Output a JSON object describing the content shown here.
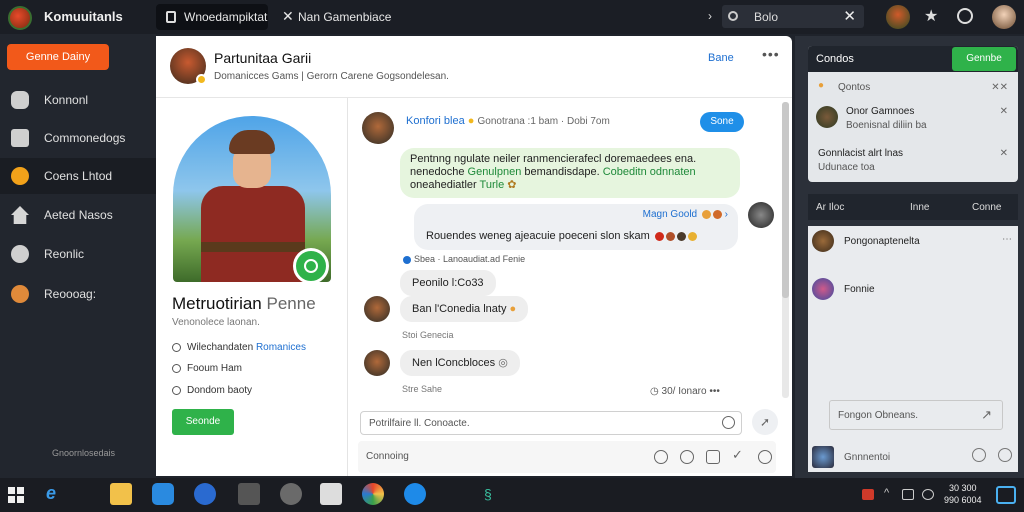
{
  "app": {
    "title": "Komuuitanls"
  },
  "tabs": [
    {
      "label": "Wnoedampiktat"
    },
    {
      "label": "Nan Gamenbiace"
    }
  ],
  "search": {
    "value": "Bolo"
  },
  "sidebar": {
    "cta_label": "Genne Dainy",
    "items": [
      {
        "label": "Konnonl"
      },
      {
        "label": "Commonedogs"
      },
      {
        "label": "Coens Lhtod"
      },
      {
        "label": "Aeted Nasos"
      },
      {
        "label": "Reonlic"
      },
      {
        "label": "Reoooag:"
      }
    ],
    "footer": "Gnoornlosedais"
  },
  "header": {
    "title": "Partunitaa Garii",
    "subtitle": "Domanicces  Gams  |  Gerorn  Carene   Gogsondelesan.",
    "link": "Bane"
  },
  "profile": {
    "name": "Metruotirian",
    "name_suffix": "Penne",
    "subtitle": "Venonolece laonan.",
    "details": [
      {
        "text": "Wilechandaten",
        "link": "Romanices"
      },
      {
        "text": "Fooum Ham"
      },
      {
        "text": "Dondom baoty"
      }
    ],
    "button": "Seonde"
  },
  "chat": {
    "sender_name": "Konfori blea",
    "sender_meta": "Gonotrana :1 bam  ·  Dobi 7om",
    "pill": "Sone",
    "green_message_plain": "Pentnng ngulate neiler ranmencierafecl doremaedees ena.",
    "green_message_line2": "nenedoche",
    "green_message_line2_hl": "Genulpnen",
    "green_message_line2_rest": "bemandisdape.",
    "green_message_line2_hl2": "Cobeditn odnnaten",
    "green_message_line3": "oneahediatler",
    "green_message_line3_hl": "Turle",
    "grey_top": "Magn Goold",
    "grey_bottom": "Rouendes weneg ajeacuie poeceni slon skam",
    "meta_line": "Sbea  ·  Lanoaudiat.ad  Fenie",
    "msg1": "Peonilo l:Co33",
    "msg2": "Ban l'Conedia lnaty",
    "time2": "Stoi  Genecia",
    "msg3": "Nen lConcbloces",
    "time3": "Stre  Sahe",
    "row_meta": "30/  Ionaro",
    "compose_placeholder": "Potrilfaire ll. Conoacte.",
    "toolbar_placeholder": "Connoing"
  },
  "right": {
    "header": "Condos",
    "header_button": "Gennbe",
    "rows": [
      {
        "text": "Qontos"
      },
      {
        "text": "Onor Gamnoes",
        "sub": "Boenisnal diliin ba"
      },
      {
        "text": "Gonnlacist alrt lnas",
        "sub": "Udunace toa"
      }
    ],
    "bar_left": "Ar  Iloc",
    "bar_mid": "Inne",
    "bar_right": "Conne",
    "list": [
      {
        "text": "Pongonaptenelta"
      },
      {
        "text": "Fonnie"
      }
    ],
    "input_placeholder": "Fongon Obneans.",
    "bottom_label": "Gnnnentoi"
  },
  "taskbar": {
    "clock_time": "30 300",
    "clock_date": "990 6004"
  },
  "colors": {
    "accent_orange": "#f2591a",
    "accent_green": "#2fb24a",
    "accent_blue": "#1f8fe8",
    "bg_dark": "#1f232b"
  }
}
